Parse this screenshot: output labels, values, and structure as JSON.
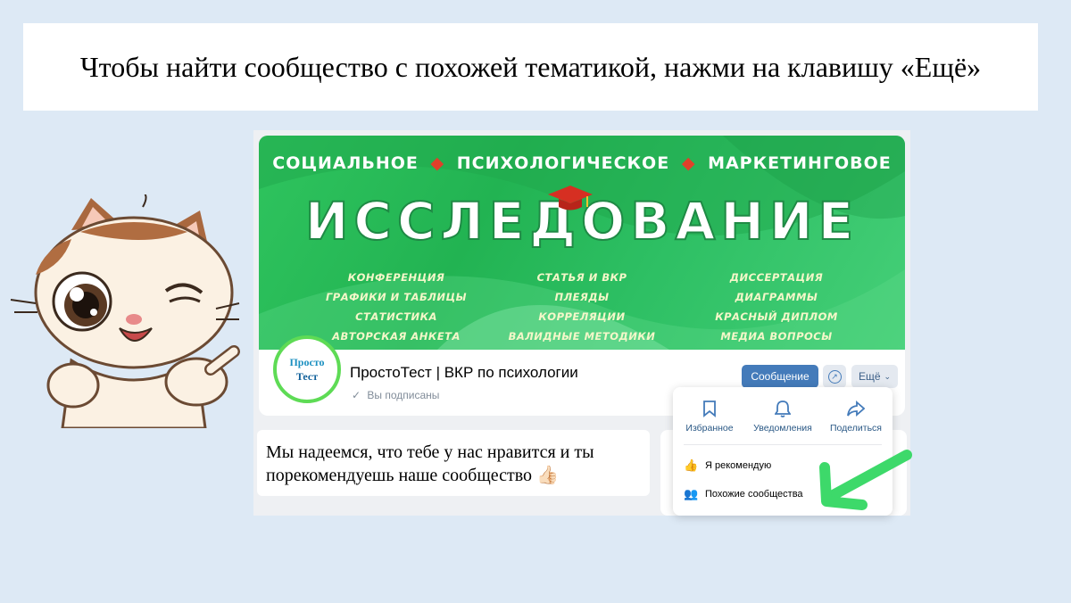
{
  "instruction": "Чтобы найти сообщество с похожей тематикой, нажми на клавишу «Ещё»",
  "cover": {
    "subtitle_parts": [
      "СОЦИАЛЬНОЕ",
      "ПСИХОЛОГИЧЕСКОЕ",
      "МАРКЕТИНГОВОЕ"
    ],
    "separator": "◆",
    "headline": "ИССЛЕДОВАНИЕ",
    "topics_left": [
      "КОНФЕРЕНЦИЯ",
      "ГРАФИКИ И ТАБЛИЦЫ",
      "СТАТИСТИКА",
      "АВТОРСКАЯ АНКЕТА"
    ],
    "topics_center": [
      "СТАТЬЯ И ВКР",
      "ПЛЕЯДЫ",
      "КОРРЕЛЯЦИИ",
      "ВАЛИДНЫЕ МЕТОДИКИ"
    ],
    "topics_right": [
      "ДИССЕРТАЦИЯ",
      "ДИАГРАММЫ",
      "КРАСНЫЙ ДИПЛОМ",
      "МЕДИА ВОПРОСЫ"
    ]
  },
  "profile": {
    "avatar_line1": "Просто",
    "avatar_line2": "Тест",
    "group_name": "ПростоТест | ВКР по психологии",
    "subscribed_label": "Вы подписаны",
    "message_button": "Сообщение",
    "more_button": "Ещё"
  },
  "dropdown": {
    "favorites": "Избранное",
    "notifications": "Уведомления",
    "share": "Поделиться",
    "recommend": "Я рекомендую",
    "similar": "Похожие сообщества"
  },
  "post": {
    "text": "Мы надеемся, что тебе у нас нравится и ты порекомендуешь наше сообщество 👍🏻"
  },
  "colors": {
    "page_bg": "#dde9f5",
    "cover_green": "#22b352",
    "vk_blue": "#447bba",
    "arrow_green": "#3dd96a",
    "avatar_ring": "#5edb55"
  },
  "icons": [
    "bookmark-icon",
    "bell-icon",
    "share-arrow-icon",
    "thumbs-up-icon",
    "people-icon",
    "chevron-down-icon",
    "checkmark-icon"
  ]
}
